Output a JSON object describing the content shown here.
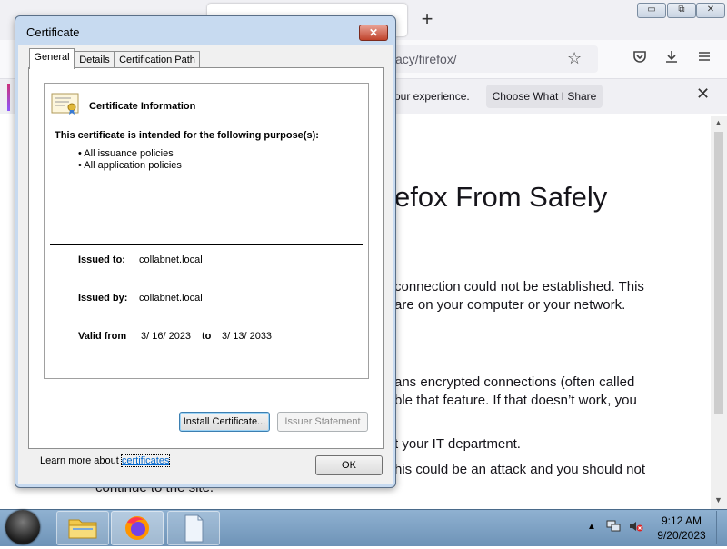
{
  "browser": {
    "url_fragment": "acy/firefox/",
    "new_tab_glyph": "+",
    "window_buttons": {
      "minimize": "▭",
      "restore": "⧉",
      "close": "✕"
    },
    "infobar": {
      "text": "our experience.",
      "button": "Choose What I Share",
      "close": "✕"
    },
    "page": {
      "heading": "efox From Safely",
      "lines": [
        "connection could not be established. This",
        "are on your computer or your network.",
        "ans encrypted connections (often called",
        "ble that feature. If that doesn’t work, you",
        "t your IT department.",
        "his could be an attack and you should not"
      ],
      "tail": "continue to the site."
    }
  },
  "dialog": {
    "title": "Certificate",
    "close": "✕",
    "tabs": [
      "General",
      "Details",
      "Certification Path"
    ],
    "info_title": "Certificate Information",
    "purpose_heading": "This certificate is intended for the following purpose(s):",
    "purposes": [
      "• All issuance policies",
      "• All application policies"
    ],
    "issued_to_label": "Issued to:",
    "issued_to": "collabnet.local",
    "issued_by_label": "Issued by:",
    "issued_by": "collabnet.local",
    "valid_from_label": "Valid from",
    "valid_from": "3/ 16/ 2023",
    "valid_to_label": "to",
    "valid_to": "3/ 13/ 2033",
    "install_button": "Install Certificate...",
    "issuer_button": "Issuer Statement",
    "learn_prefix": "Learn more about",
    "learn_link": "certificates",
    "ok_button": "OK"
  },
  "taskbar": {
    "time": "9:12 AM",
    "date": "9/20/2023",
    "tray_arrow": "▲"
  }
}
